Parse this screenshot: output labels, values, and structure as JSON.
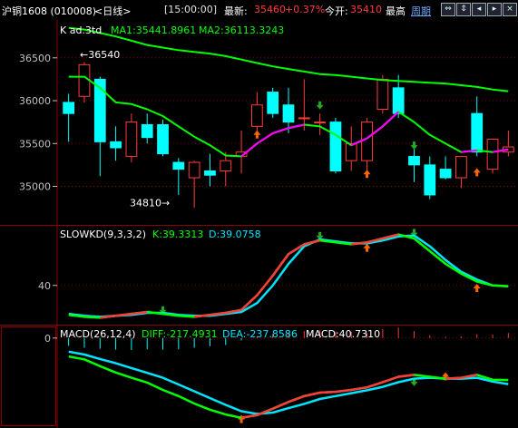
{
  "header": {
    "instrument": "沪铜1608 (010008)",
    "period": "<日线>",
    "time": "[15:00:00]",
    "latest_label": "最新:",
    "latest_value": "35460",
    "change": "+0.37%",
    "open_label": "今开:",
    "open_value": "35410",
    "high_label": "最高",
    "period_link": "周期",
    "nav_icons": [
      "arrow-left-right-icon",
      "arrow-up-down-icon",
      "arrow-left-icon",
      "arrow-right-icon",
      "close-icon"
    ]
  },
  "colors": {
    "up": "#ff3b3b",
    "down": "#00ffff",
    "ma1": "#ff00ff",
    "ma2": "#00ff00",
    "grid": "#8b0000",
    "axis_text": "#c0c0c0",
    "value_text": "#ffffff",
    "arrow_up": "#ff6600",
    "arrow_down": "#22aa22"
  },
  "chart_data": [
    {
      "type": "candlestick",
      "legend": {
        "name": "K ad.3td",
        "ma1": "MA1:35441.8961",
        "ma2": "MA2:36113.3243"
      },
      "y_ticks": [
        36500,
        36000,
        35500,
        35000
      ],
      "ylim": [
        34550,
        36900
      ],
      "annotations": [
        {
          "text": "←36540",
          "value": 36540
        },
        {
          "text": "34810→",
          "value": 34810
        }
      ],
      "candles": [
        [
          35980,
          36080,
          35520,
          35850
        ],
        [
          36050,
          36450,
          35980,
          36420
        ],
        [
          36250,
          36280,
          35120,
          35520
        ],
        [
          35520,
          35700,
          35300,
          35450
        ],
        [
          35350,
          35850,
          35280,
          35750
        ],
        [
          35720,
          35850,
          35500,
          35570
        ],
        [
          35720,
          35780,
          35350,
          35380
        ],
        [
          35280,
          35330,
          34900,
          35200
        ],
        [
          35100,
          35300,
          34750,
          35280
        ],
        [
          35180,
          35380,
          35000,
          35130
        ],
        [
          35180,
          35400,
          35000,
          35300
        ],
        [
          35350,
          35650,
          35150,
          35400
        ],
        [
          35700,
          36100,
          35600,
          35950
        ],
        [
          36100,
          36150,
          35800,
          35850
        ],
        [
          35950,
          36150,
          35620,
          35750
        ],
        [
          35800,
          36250,
          35650,
          35800
        ],
        [
          35750,
          35850,
          35600,
          35750
        ],
        [
          35750,
          35800,
          35150,
          35180
        ],
        [
          35300,
          35700,
          35180,
          35500
        ],
        [
          35300,
          35800,
          35180,
          35750
        ],
        [
          35900,
          36300,
          35850,
          36250
        ],
        [
          36150,
          36300,
          35800,
          35850
        ],
        [
          35350,
          35450,
          35050,
          35250
        ],
        [
          35250,
          35350,
          34850,
          34900
        ],
        [
          35200,
          35350,
          35080,
          35100
        ],
        [
          35100,
          35300,
          34980,
          35350
        ],
        [
          35850,
          36050,
          35350,
          35400
        ],
        [
          35200,
          35500,
          35150,
          35550
        ],
        [
          35400,
          35650,
          35350,
          35460
        ]
      ],
      "ma1": [
        36280,
        36280,
        36150,
        35980,
        35960,
        35900,
        35820,
        35700,
        35580,
        35480,
        35360,
        35350,
        35500,
        35620,
        35680,
        35720,
        35700,
        35600,
        35480,
        35560,
        35700,
        35870,
        35750,
        35600,
        35500,
        35400,
        35420,
        35400,
        35430
      ],
      "ma2": [
        36850,
        36830,
        36790,
        36750,
        36700,
        36650,
        36620,
        36590,
        36570,
        36550,
        36520,
        36480,
        36440,
        36400,
        36370,
        36340,
        36310,
        36300,
        36280,
        36260,
        36240,
        36230,
        36220,
        36210,
        36200,
        36180,
        36160,
        36130,
        36110
      ],
      "signals": [
        {
          "index": 16,
          "dir": "down",
          "value": 35950
        },
        {
          "index": 12,
          "dir": "up",
          "value": 35600
        },
        {
          "index": 19,
          "dir": "up",
          "value": 35140
        },
        {
          "index": 22,
          "dir": "down",
          "value": 35480
        },
        {
          "index": 26,
          "dir": "up",
          "value": 35160
        }
      ]
    },
    {
      "type": "line",
      "legend": {
        "name": "SLOWKD(9,3,3,2)",
        "k": "K:39.3313",
        "d": "D:39.0758"
      },
      "y_ticks": [
        40
      ],
      "ylim": [
        0,
        100
      ],
      "k": [
        10,
        8,
        7,
        9,
        11,
        13,
        11,
        9,
        8,
        10,
        12,
        15,
        30,
        50,
        72,
        82,
        86,
        84,
        82,
        84,
        88,
        92,
        88,
        75,
        62,
        52,
        44,
        40,
        39.3
      ],
      "d": [
        11,
        9,
        8,
        9,
        10,
        12,
        12,
        10,
        9,
        9,
        11,
        13,
        22,
        40,
        62,
        80,
        87,
        85,
        83,
        83,
        86,
        90,
        91,
        80,
        66,
        54,
        46,
        40,
        39.1
      ],
      "signals": [
        {
          "index": 6,
          "dir": "down",
          "value": 15
        },
        {
          "index": 16,
          "dir": "down",
          "value": 91
        },
        {
          "index": 19,
          "dir": "up",
          "value": 78
        },
        {
          "index": 22,
          "dir": "down",
          "value": 94
        },
        {
          "index": 26,
          "dir": "up",
          "value": 37
        }
      ]
    },
    {
      "type": "macd",
      "legend": {
        "name": "MACD(26,12,4)",
        "diff": "DIFF:-217.4931",
        "dea": "DEA:-237.8586",
        "macd": "MACD:40.7310"
      },
      "y_ticks": [
        0
      ],
      "ylim": [
        -460,
        60
      ],
      "diff": [
        -95,
        -110,
        -145,
        -178,
        -205,
        -230,
        -268,
        -300,
        -338,
        -370,
        -395,
        -412,
        -398,
        -365,
        -330,
        -300,
        -282,
        -278,
        -268,
        -255,
        -228,
        -200,
        -190,
        -200,
        -210,
        -205,
        -190,
        -215,
        -217
      ],
      "dea": [
        -70,
        -85,
        -108,
        -130,
        -155,
        -180,
        -205,
        -240,
        -275,
        -310,
        -345,
        -378,
        -392,
        -385,
        -362,
        -340,
        -315,
        -300,
        -285,
        -270,
        -252,
        -228,
        -210,
        -205,
        -210,
        -210,
        -205,
        -225,
        -238
      ],
      "bars": [
        -40,
        -50,
        -55,
        -60,
        -62,
        -58,
        -60,
        -58,
        -50,
        -42,
        -36,
        -12,
        10,
        22,
        30,
        36,
        40,
        34,
        32,
        28,
        46,
        54,
        36,
        14,
        6,
        8,
        20,
        18,
        26
      ],
      "signals": [
        {
          "index": 11,
          "dir": "up",
          "value": -420
        },
        {
          "index": 22,
          "dir": "down",
          "value": -225
        },
        {
          "index": 24,
          "dir": "up",
          "value": -200
        }
      ]
    }
  ]
}
